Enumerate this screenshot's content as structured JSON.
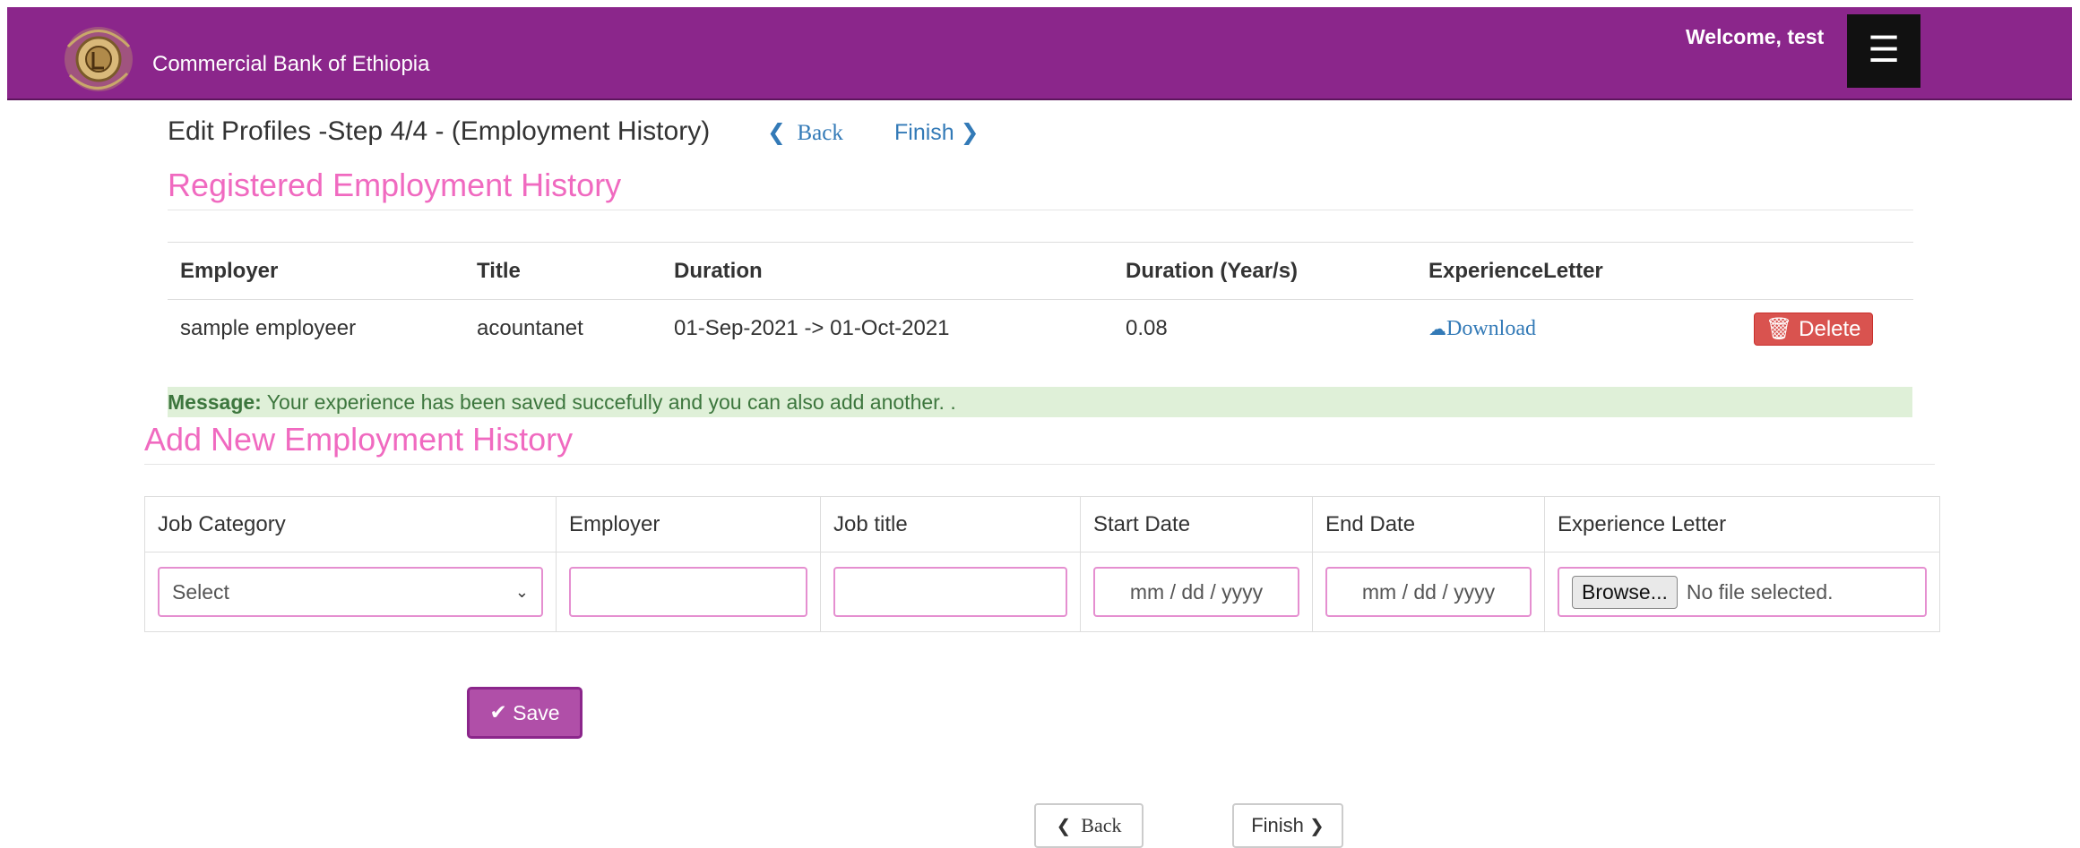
{
  "header": {
    "bank_name": "Commercial Bank of Ethiopia",
    "welcome_text": "Welcome, test",
    "menu_icon": "hamburger-icon",
    "brand_color": "#8b268b"
  },
  "page": {
    "title": "Edit Profiles -Step 4/4 - (Employment History)",
    "back_label": "Back",
    "finish_label": "Finish"
  },
  "registered": {
    "heading": "Registered Employment History",
    "columns": [
      "Employer",
      "Title",
      "Duration",
      "Duration (Year/s)",
      "ExperienceLetter",
      ""
    ],
    "rows": [
      {
        "employer": "sample employeer",
        "title": "acountanet",
        "duration": "01-Sep-2021 -> 01-Oct-2021",
        "years": "0.08",
        "download_label": "Download",
        "delete_label": "Delete"
      }
    ]
  },
  "message": {
    "label": "Message:",
    "text": " Your experience has been saved succefully and you can also add another. ."
  },
  "add_form": {
    "heading": "Add New Employment History",
    "columns": [
      "Job Category",
      "Employer",
      "Job title",
      "Start Date",
      "End Date",
      "Experience Letter"
    ],
    "job_category_selected": "Select",
    "employer_value": "",
    "job_title_value": "",
    "start_date_placeholder": "mm / dd / yyyy",
    "end_date_placeholder": "mm / dd / yyyy",
    "browse_label": "Browse...",
    "file_status": "No file selected.",
    "save_label": "Save"
  },
  "footer_nav": {
    "back_label": "Back",
    "finish_label": "Finish"
  },
  "colors": {
    "heading_pink": "#f06ac0",
    "link_blue": "#337ab7",
    "delete_red": "#d9534f",
    "success_bg": "#dff0d8",
    "success_text": "#3c763d"
  }
}
